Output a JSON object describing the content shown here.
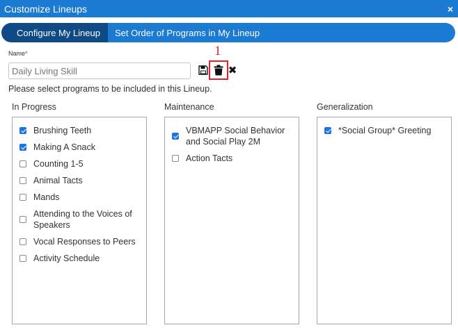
{
  "window": {
    "title": "Customize Lineups",
    "close_glyph": "×"
  },
  "tabs": [
    {
      "label": "Configure My Lineup",
      "active": true
    },
    {
      "label": "Set Order of Programs in My Lineup",
      "active": false
    }
  ],
  "name_field": {
    "label": "Name",
    "required_mark": "*",
    "value": "Daily Living Skill"
  },
  "toolbar": {
    "save_icon": "floppy-disk-icon",
    "delete_icon": "trash-icon",
    "discard_icon": "x-icon",
    "discard_glyph": "✖"
  },
  "annotation": {
    "marker": "1"
  },
  "instructions": "Please select programs to be included in this Lineup.",
  "columns": [
    {
      "title": "In Progress",
      "items": [
        {
          "label": "Brushing Teeth",
          "checked": true
        },
        {
          "label": "Making A Snack",
          "checked": true
        },
        {
          "label": "Counting 1-5",
          "checked": false
        },
        {
          "label": "Animal Tacts",
          "checked": false
        },
        {
          "label": "Mands",
          "checked": false
        },
        {
          "label": "Attending to the Voices of Speakers",
          "checked": false
        },
        {
          "label": "Vocal Responses to Peers",
          "checked": false
        },
        {
          "label": "Activity Schedule",
          "checked": false
        }
      ]
    },
    {
      "title": "Maintenance",
      "items": [
        {
          "label": "VBMAPP Social Behavior and Social Play 2M",
          "checked": true
        },
        {
          "label": "Action Tacts",
          "checked": false
        }
      ]
    },
    {
      "title": "Generalization",
      "items": [
        {
          "label": "*Social Group* Greeting",
          "checked": true
        }
      ]
    }
  ],
  "colors": {
    "primary": "#1b7ad1",
    "active_tab": "#0f4a86",
    "highlight": "#e41f2d",
    "checkbox": "#1a73e8"
  }
}
